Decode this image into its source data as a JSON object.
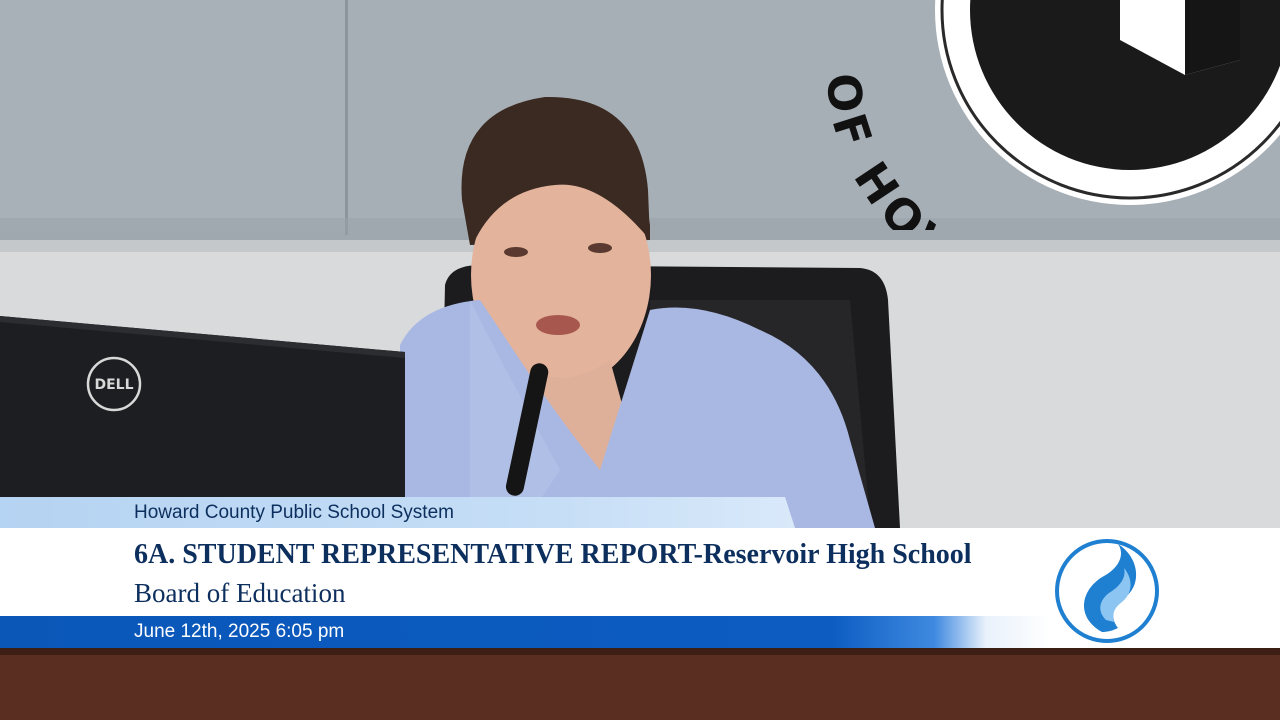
{
  "overlay": {
    "organization": "Howard County Public School System",
    "agenda_item": "6A. STUDENT REPRESENTATIVE REPORT-Reservoir High School",
    "body": "Board of Education",
    "datetime": "June 12th, 2025 6:05 pm"
  },
  "scene": {
    "seal_text": "OF HOWARD C",
    "laptop_brand": "DELL"
  },
  "colors": {
    "navy_text": "#0d2f5e",
    "date_bar_blue": "#0a57b8",
    "org_bar_light_blue": "#b5d3f2",
    "logo_blue": "#1f7fd0",
    "wall_gray": "#a9b1b8",
    "desk_brown": "#5a2f22"
  },
  "icons": {
    "hcpss_logo": "flame-logo-icon",
    "dell_logo": "dell-logo-icon"
  }
}
